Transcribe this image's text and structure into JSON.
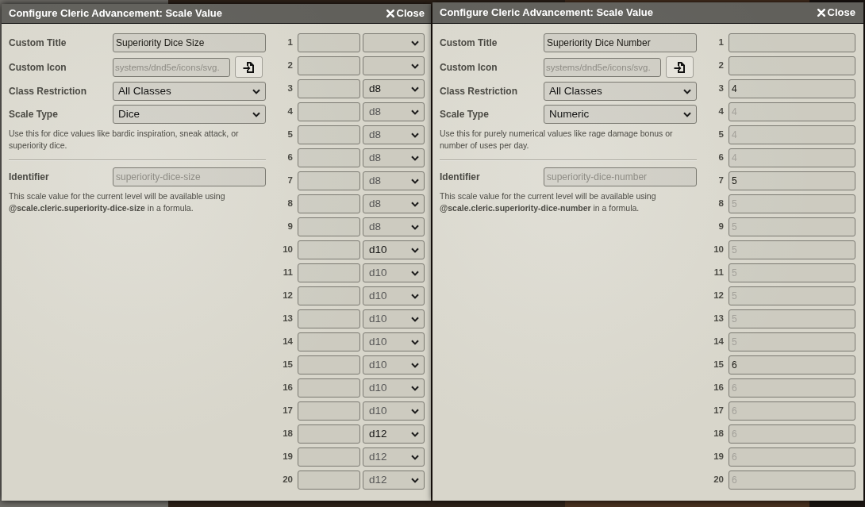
{
  "windows": [
    {
      "kind": "dice",
      "title": "Configure Cleric Advancement: Scale Value",
      "close": "Close",
      "custom_title": {
        "label": "Custom Title",
        "value": "Superiority Dice Size"
      },
      "custom_icon": {
        "label": "Custom Icon",
        "placeholder": "systems/dnd5e/icons/svg."
      },
      "class_restriction": {
        "label": "Class Restriction",
        "value": "All Classes"
      },
      "scale_type": {
        "label": "Scale Type",
        "value": "Dice",
        "hint": "Use this for dice values like bardic inspiration, sneak attack, or superiority dice."
      },
      "identifier": {
        "label": "Identifier",
        "placeholder": "superiority-dice-size",
        "hint": "This scale value for the current level will be available using **@scale.cleric.superiority-dice-size** in a formula."
      },
      "levels": [
        {
          "level": "1"
        },
        {
          "level": "2"
        },
        {
          "level": "3",
          "value": "d8"
        },
        {
          "level": "4",
          "placeholder": "d8"
        },
        {
          "level": "5",
          "placeholder": "d8"
        },
        {
          "level": "6",
          "placeholder": "d8"
        },
        {
          "level": "7",
          "placeholder": "d8"
        },
        {
          "level": "8",
          "placeholder": "d8"
        },
        {
          "level": "9",
          "placeholder": "d8"
        },
        {
          "level": "10",
          "value": "d10"
        },
        {
          "level": "11",
          "placeholder": "d10"
        },
        {
          "level": "12",
          "placeholder": "d10"
        },
        {
          "level": "13",
          "placeholder": "d10"
        },
        {
          "level": "14",
          "placeholder": "d10"
        },
        {
          "level": "15",
          "placeholder": "d10"
        },
        {
          "level": "16",
          "placeholder": "d10"
        },
        {
          "level": "17",
          "placeholder": "d10"
        },
        {
          "level": "18",
          "value": "d12"
        },
        {
          "level": "19",
          "placeholder": "d12"
        },
        {
          "level": "20",
          "placeholder": "d12"
        }
      ]
    },
    {
      "kind": "numeric",
      "title": "Configure Cleric Advancement: Scale Value",
      "close": "Close",
      "custom_title": {
        "label": "Custom Title",
        "value": "Superiority Dice Number"
      },
      "custom_icon": {
        "label": "Custom Icon",
        "placeholder": "systems/dnd5e/icons/svg."
      },
      "class_restriction": {
        "label": "Class Restriction",
        "value": "All Classes"
      },
      "scale_type": {
        "label": "Scale Type",
        "value": "Numeric",
        "hint": "Use this for purely numerical values like rage damage bonus or number of uses per day."
      },
      "identifier": {
        "label": "Identifier",
        "placeholder": "superiority-dice-number",
        "hint": "This scale value for the current level will be available using **@scale.cleric.superiority-dice-number** in a formula."
      },
      "levels": [
        {
          "level": "1"
        },
        {
          "level": "2"
        },
        {
          "level": "3",
          "value": "4"
        },
        {
          "level": "4",
          "placeholder": "4"
        },
        {
          "level": "5",
          "placeholder": "4"
        },
        {
          "level": "6",
          "placeholder": "4"
        },
        {
          "level": "7",
          "value": "5"
        },
        {
          "level": "8",
          "placeholder": "5"
        },
        {
          "level": "9",
          "placeholder": "5"
        },
        {
          "level": "10",
          "placeholder": "5"
        },
        {
          "level": "11",
          "placeholder": "5"
        },
        {
          "level": "12",
          "placeholder": "5"
        },
        {
          "level": "13",
          "placeholder": "5"
        },
        {
          "level": "14",
          "placeholder": "5"
        },
        {
          "level": "15",
          "value": "6"
        },
        {
          "level": "16",
          "placeholder": "6"
        },
        {
          "level": "17",
          "placeholder": "6"
        },
        {
          "level": "18",
          "placeholder": "6"
        },
        {
          "level": "19",
          "placeholder": "6"
        },
        {
          "level": "20",
          "placeholder": "6"
        }
      ]
    }
  ]
}
